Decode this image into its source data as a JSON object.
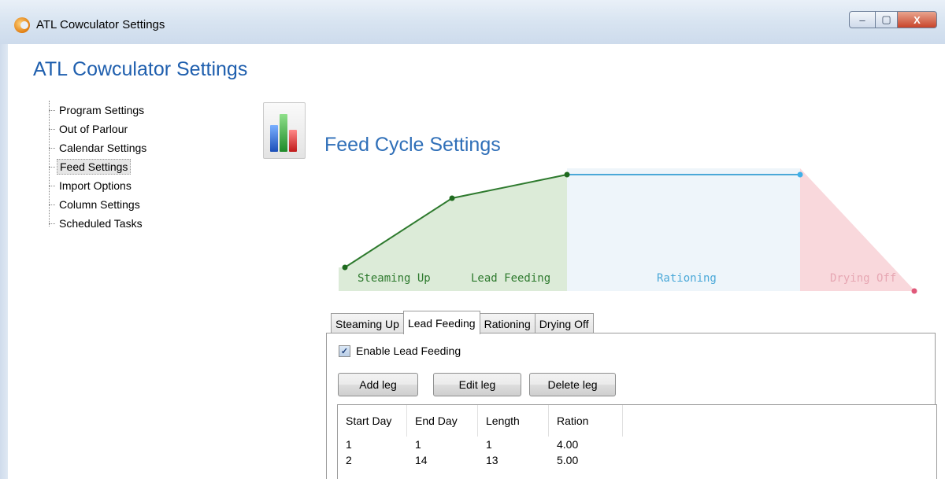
{
  "window": {
    "title": "ATL Cowculator Settings",
    "controls": {
      "minimize": "–",
      "maximize": "▢",
      "close": "X"
    }
  },
  "app_title": "ATL Cowculator Settings",
  "nav": {
    "items": [
      {
        "label": "Program Settings",
        "selected": false
      },
      {
        "label": "Out of Parlour",
        "selected": false
      },
      {
        "label": "Calendar Settings",
        "selected": false
      },
      {
        "label": "Feed Settings",
        "selected": true
      },
      {
        "label": "Import Options",
        "selected": false
      },
      {
        "label": "Column Settings",
        "selected": false
      },
      {
        "label": "Scheduled Tasks",
        "selected": false
      }
    ]
  },
  "section": {
    "title": "Feed Cycle Settings",
    "icon": "bar-chart-icon"
  },
  "diagram": {
    "phases": [
      {
        "label": "Steaming Up",
        "color": "#2e7a2e",
        "fill": "#dcebd8"
      },
      {
        "label": "Lead Feeding",
        "color": "#2e7a2e",
        "fill": "#dcebd8"
      },
      {
        "label": "Rationing",
        "color": "#4aa8d8",
        "fill": "#eef5fa"
      },
      {
        "label": "Drying Off",
        "color": "#e7a7b3",
        "fill": "#f9d8dc"
      }
    ]
  },
  "tabs": [
    {
      "label": "Steaming Up",
      "active": false
    },
    {
      "label": "Lead Feeding",
      "active": true
    },
    {
      "label": "Rationing",
      "active": false
    },
    {
      "label": "Drying Off",
      "active": false
    }
  ],
  "enable_checkbox": {
    "label": "Enable Lead Feeding",
    "checked": true
  },
  "buttons": {
    "add": "Add leg",
    "edit": "Edit leg",
    "delete": "Delete leg"
  },
  "legs_table": {
    "columns": [
      "Start Day",
      "End Day",
      "Length",
      "Ration"
    ],
    "rows": [
      [
        "1",
        "1",
        "1",
        "4.00"
      ],
      [
        "2",
        "14",
        "13",
        "5.00"
      ]
    ]
  }
}
